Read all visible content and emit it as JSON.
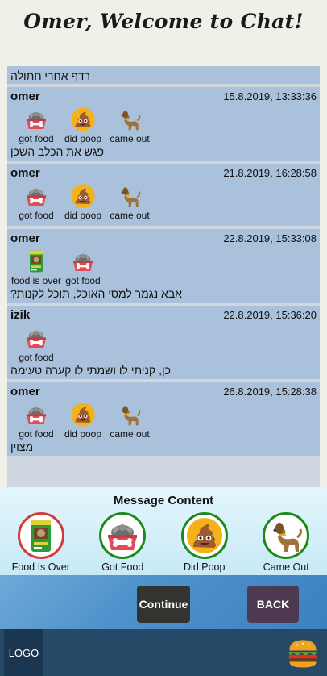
{
  "app": {
    "title": "Omer, Welcome to Chat!"
  },
  "icons": {
    "food_is_over": "food-bag-icon",
    "got_food": "dog-bowl-icon",
    "did_poop": "poop-icon",
    "came_out": "dog-icon"
  },
  "chat": {
    "partial_text": "רדף אחרי חתולה",
    "messages": [
      {
        "user": "omer",
        "time": "15.8.2019, 13:33:36",
        "icons": [
          "got food",
          "did poop",
          "came out"
        ],
        "text": "פגש את הכלב השכן"
      },
      {
        "user": "omer",
        "time": "21.8.2019, 16:28:58",
        "icons": [
          "got food",
          "did poop",
          "came out"
        ],
        "text": ""
      },
      {
        "user": "omer",
        "time": "22.8.2019, 15:33:08",
        "icons": [
          "food is over",
          "got food"
        ],
        "text": "אבא נגמר למסי האוכל, תוכל לקנות?"
      },
      {
        "user": "izik",
        "time": "22.8.2019, 15:36:20",
        "icons": [
          "got food"
        ],
        "text": "כן, קניתי לו ושמתי לו קערה טעימה"
      },
      {
        "user": "omer",
        "time": "26.8.2019, 15:28:38",
        "icons": [
          "got food",
          "did poop",
          "came out"
        ],
        "text": "מצוין"
      }
    ]
  },
  "content_panel": {
    "title": "Message Content",
    "options": [
      {
        "label": "Food Is Over",
        "ring_color": "#d23b3b"
      },
      {
        "label": "Got Food",
        "ring_color": "#1a8a1a"
      },
      {
        "label": "Did Poop",
        "ring_color": "#1a8a1a"
      },
      {
        "label": "Came Out",
        "ring_color": "#1a8a1a"
      }
    ]
  },
  "actions": {
    "continue": "Continue",
    "back": "BACK"
  },
  "footer": {
    "logo": "LOGO"
  }
}
